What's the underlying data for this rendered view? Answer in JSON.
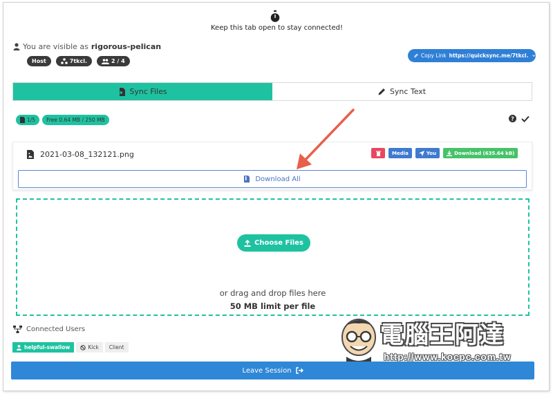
{
  "header": {
    "message": "Keep this tab open to stay connected!",
    "icon": "stopwatch-icon"
  },
  "identity": {
    "prefix": "You are visible as",
    "username": "rigorous-pelican",
    "badges": {
      "role": "Host",
      "network": "7tkcl.",
      "users": "2 / 4"
    }
  },
  "copy_link": {
    "label": "Copy Link",
    "url": "https://quicksync.me/7tkcl."
  },
  "tabs": [
    {
      "label": "Sync Files",
      "active": true
    },
    {
      "label": "Sync Text",
      "active": false
    }
  ],
  "status": {
    "count": "1/5",
    "storage": "Free 0.64 MB / 250 MB"
  },
  "file": {
    "name": "2021-03-08_132121.png",
    "actions": {
      "media": "Media",
      "you": "You",
      "download": "Download (635.64 kB)"
    }
  },
  "download_all": "Download All",
  "dropzone": {
    "button": "Choose Files",
    "hint": "or drag and drop files here",
    "limit": "50 MB limit per file"
  },
  "connected": {
    "title": "Connected Users",
    "user": "helpful-swallow",
    "kick": "Kick",
    "role": "Client"
  },
  "leave": "Leave Session",
  "watermark": {
    "name": "電腦王阿達",
    "url": "http://www.kocpc.com.tw"
  },
  "colors": {
    "accent": "#1fc2a0",
    "primary": "#2f87d7",
    "danger": "#e84860",
    "success": "#46c26a",
    "annotation": "#e8604a"
  }
}
